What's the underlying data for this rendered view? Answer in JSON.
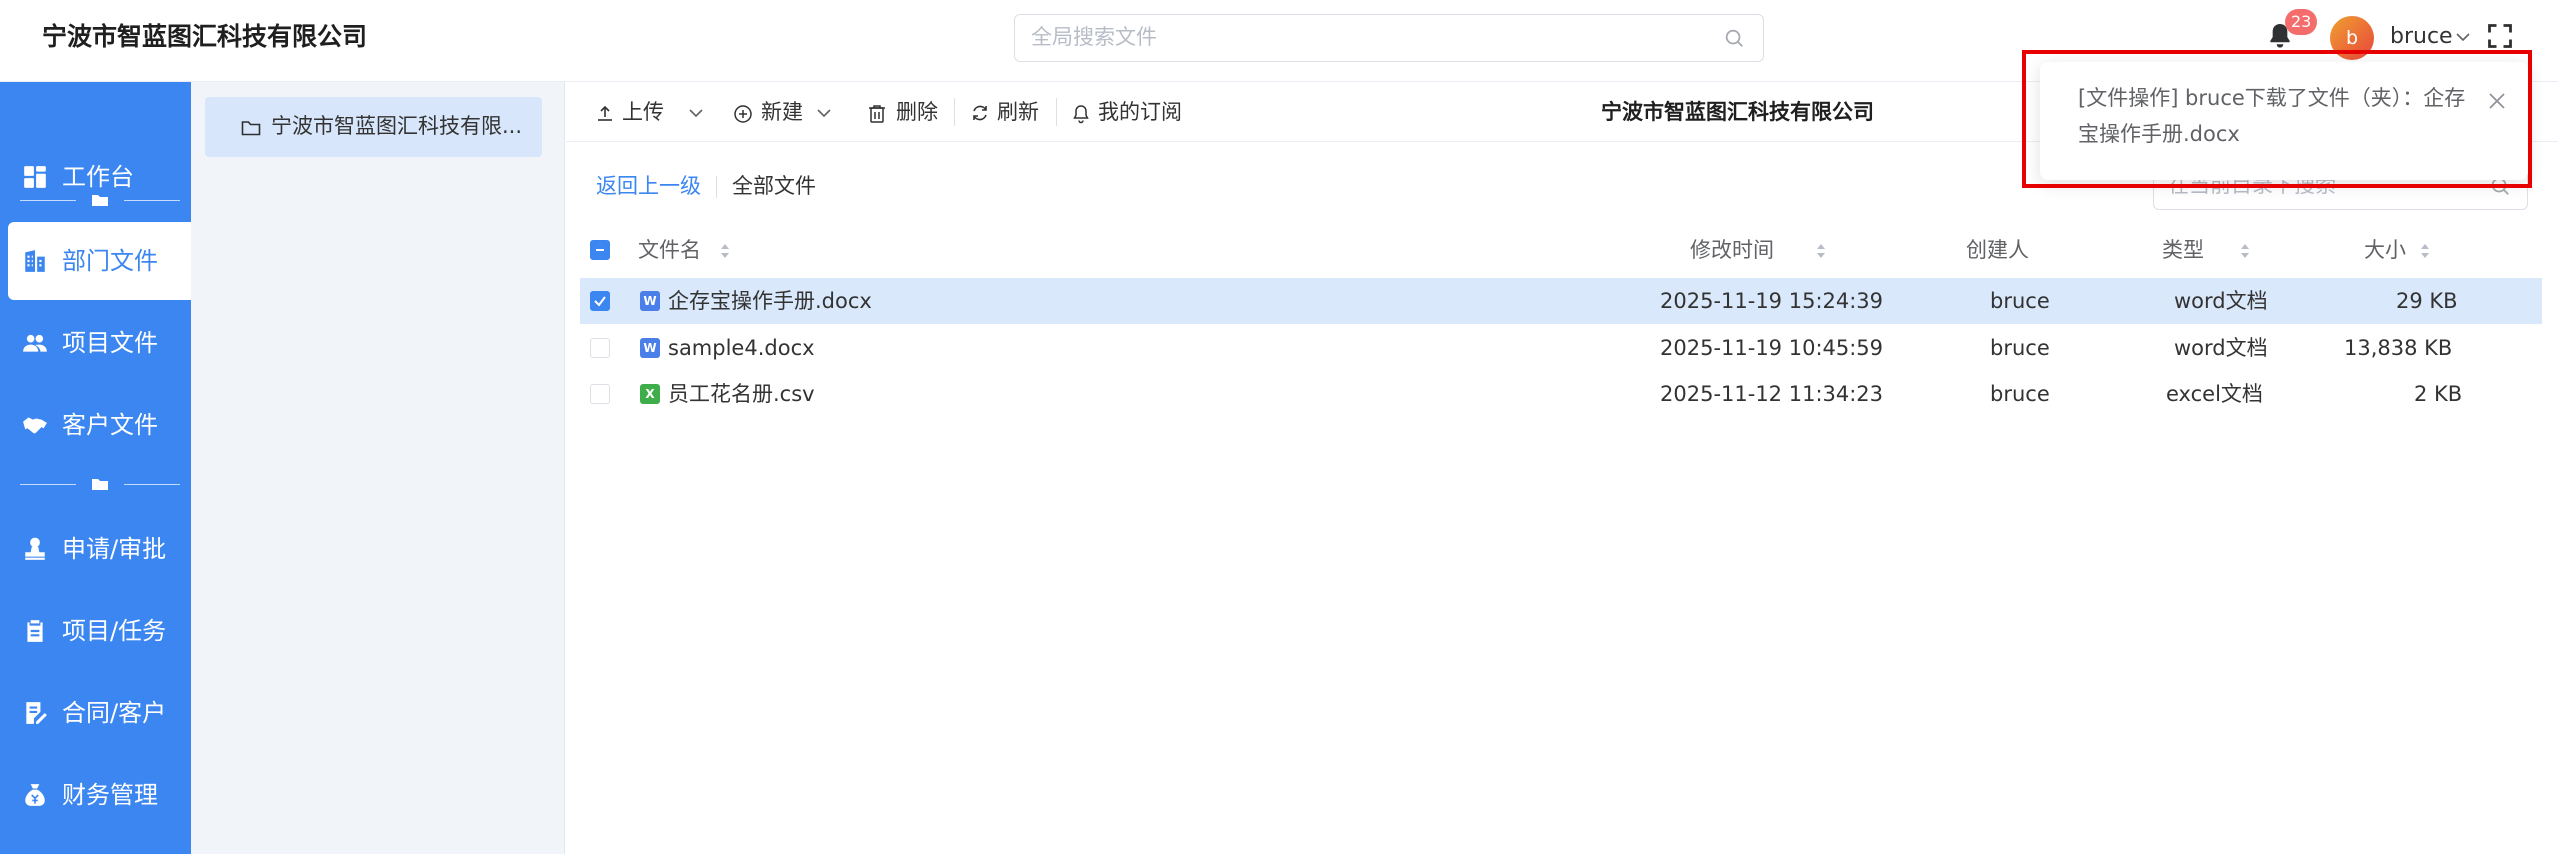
{
  "header": {
    "company": "宁波市智蓝图汇科技有限公司",
    "search_placeholder": "全局搜索文件",
    "notification_count": "23",
    "avatar_initial": "b",
    "username": "bruce"
  },
  "nav": {
    "items": [
      {
        "label": "工作台",
        "icon": "dashboard-icon"
      },
      {
        "label": "部门文件",
        "icon": "building-icon",
        "active": true
      },
      {
        "label": "项目文件",
        "icon": "users-icon"
      },
      {
        "label": "客户文件",
        "icon": "handshake-icon"
      },
      {
        "label": "申请/审批",
        "icon": "stamp-icon"
      },
      {
        "label": "项目/任务",
        "icon": "clipboard-icon"
      },
      {
        "label": "合同/客户",
        "icon": "contract-icon"
      },
      {
        "label": "财务管理",
        "icon": "money-bag-icon"
      }
    ]
  },
  "tree": {
    "root_label": "宁波市智蓝图汇科技有限..."
  },
  "toolbar": {
    "upload": "上传",
    "new": "新建",
    "delete": "删除",
    "refresh": "刷新",
    "subscribe": "我的订阅",
    "title": "宁波市智蓝图汇科技有限公司"
  },
  "breadcrumb": {
    "back": "返回上一级",
    "all": "全部文件"
  },
  "dir_search_placeholder": "在当前目录下搜索",
  "table": {
    "headers": {
      "name": "文件名",
      "modified": "修改时间",
      "creator": "创建人",
      "type": "类型",
      "size": "大小"
    },
    "rows": [
      {
        "icon": "W",
        "icon_color": "#4a7ee8",
        "name": "企存宝操作手册.docx",
        "modified": "2025-11-19 15:24:39",
        "creator": "bruce",
        "type": "word文档",
        "size": "29 KB",
        "selected": true
      },
      {
        "icon": "W",
        "icon_color": "#4a7ee8",
        "name": "sample4.docx",
        "modified": "2025-11-19 10:45:59",
        "creator": "bruce",
        "type": "word文档",
        "size": "13,838 KB",
        "selected": false
      },
      {
        "icon": "X",
        "icon_color": "#3fae4a",
        "name": "员工花名册.csv",
        "modified": "2025-11-12 11:34:23",
        "creator": "bruce",
        "type": "excel文档",
        "size": "2 KB",
        "selected": false
      }
    ]
  },
  "notification": {
    "text": "[文件操作] bruce下载了文件（夹）：企存宝操作手册.docx"
  },
  "colors": {
    "accent": "#3b86f0",
    "badge": "#f56c6c",
    "highlight": "#e60000",
    "selected_row": "#d9e8fb"
  }
}
